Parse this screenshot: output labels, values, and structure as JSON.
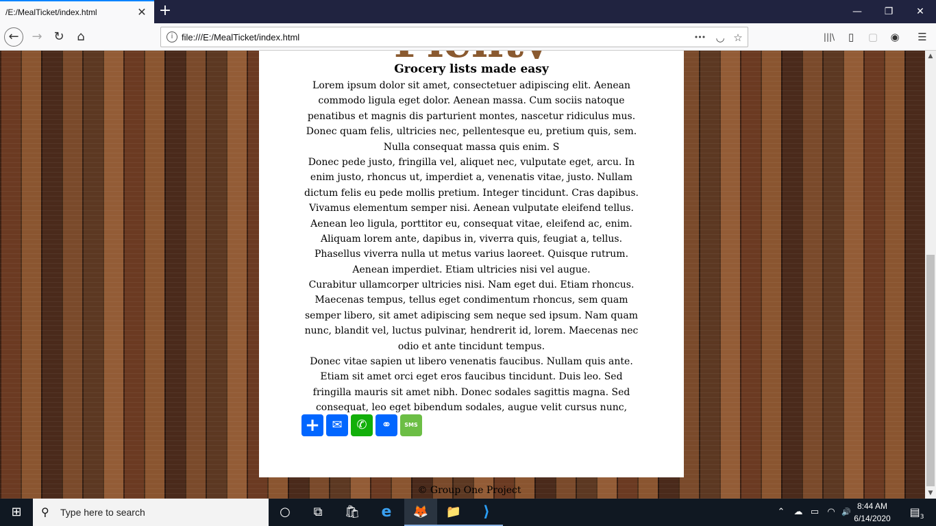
{
  "browser": {
    "tab_title": "/E:/MealTicket/index.html",
    "tab_close": "✕",
    "new_tab": "+",
    "window_controls": {
      "minimize": "—",
      "restore": "❐",
      "close": "✕"
    },
    "url": "file:///E:/MealTicket/index.html",
    "nav": {
      "back": "←",
      "forward": "→",
      "reload": "↻",
      "home": "⌂"
    },
    "url_actions": {
      "more": "•••",
      "pocket": "◡",
      "bookmark": "☆"
    },
    "toolbar": {
      "library": "|||\\",
      "sidebar": "▯",
      "extension": "▢",
      "account": "◉",
      "menu": "☰"
    }
  },
  "page": {
    "hero_word": "Plenty",
    "subtitle": "Grocery lists made easy",
    "paragraphs": [
      "Lorem ipsum dolor sit amet, consectetuer adipiscing elit. Aenean commodo ligula eget dolor. Aenean massa. Cum sociis natoque penatibus et magnis dis parturient montes, nascetur ridiculus mus. Donec quam felis, ultricies nec, pellentesque eu, pretium quis, sem. Nulla consequat massa quis enim. S",
      "Donec pede justo, fringilla vel, aliquet nec, vulputate eget, arcu. In enim justo, rhoncus ut, imperdiet a, venenatis vitae, justo. Nullam dictum felis eu pede mollis pretium. Integer tincidunt. Cras dapibus. Vivamus elementum semper nisi. Aenean vulputate eleifend tellus. Aenean leo ligula, porttitor eu, consequat vitae, eleifend ac, enim. Aliquam lorem ante, dapibus in, viverra quis, feugiat a, tellus. Phasellus viverra nulla ut metus varius laoreet. Quisque rutrum. Aenean imperdiet. Etiam ultricies nisi vel augue.",
      "Curabitur ullamcorper ultricies nisi. Nam eget dui. Etiam rhoncus. Maecenas tempus, tellus eget condimentum rhoncus, sem quam semper libero, sit amet adipiscing sem neque sed ipsum. Nam quam nunc, blandit vel, luctus pulvinar, hendrerit id, lorem. Maecenas nec odio et ante tincidunt tempus.",
      "Donec vitae sapien ut libero venenatis faucibus. Nullam quis ante. Etiam sit amet orci eget eros faucibus tincidunt. Duis leo. Sed fringilla mauris sit amet nibh. Donec sodales sagittis magna. Sed consequat, leo eget bibendum sodales, augue velit cursus nunc,"
    ],
    "share_buttons": [
      {
        "name": "share",
        "glyph": "+",
        "color": "#0166ff"
      },
      {
        "name": "email",
        "glyph": "✉",
        "color": "#0166ff"
      },
      {
        "name": "whatsapp",
        "glyph": "✆",
        "color": "#12af0a"
      },
      {
        "name": "copy-link",
        "glyph": "⚭",
        "color": "#0166ff"
      },
      {
        "name": "sms",
        "glyph": "SMS",
        "color": "#6cbe45"
      }
    ],
    "footer": "© Group One Project"
  },
  "taskbar": {
    "start_icon": "⊞",
    "search_icon": "⚲",
    "search_placeholder": "Type here to search",
    "apps": [
      {
        "name": "cortana",
        "glyph": "○"
      },
      {
        "name": "task-view",
        "glyph": "⧉"
      },
      {
        "name": "store",
        "glyph": "🛍"
      },
      {
        "name": "edge",
        "glyph": "e"
      },
      {
        "name": "firefox",
        "glyph": "🦊"
      },
      {
        "name": "file-explorer",
        "glyph": "📁"
      },
      {
        "name": "vscode",
        "glyph": "⟩"
      }
    ],
    "tray": {
      "chevron": "⌃",
      "onedrive": "☁",
      "battery": "▭",
      "wifi": "◠",
      "volume": "🔊",
      "notifications": "▤",
      "notification_count": "3"
    },
    "time": "8:44 AM",
    "date": "6/14/2020"
  }
}
